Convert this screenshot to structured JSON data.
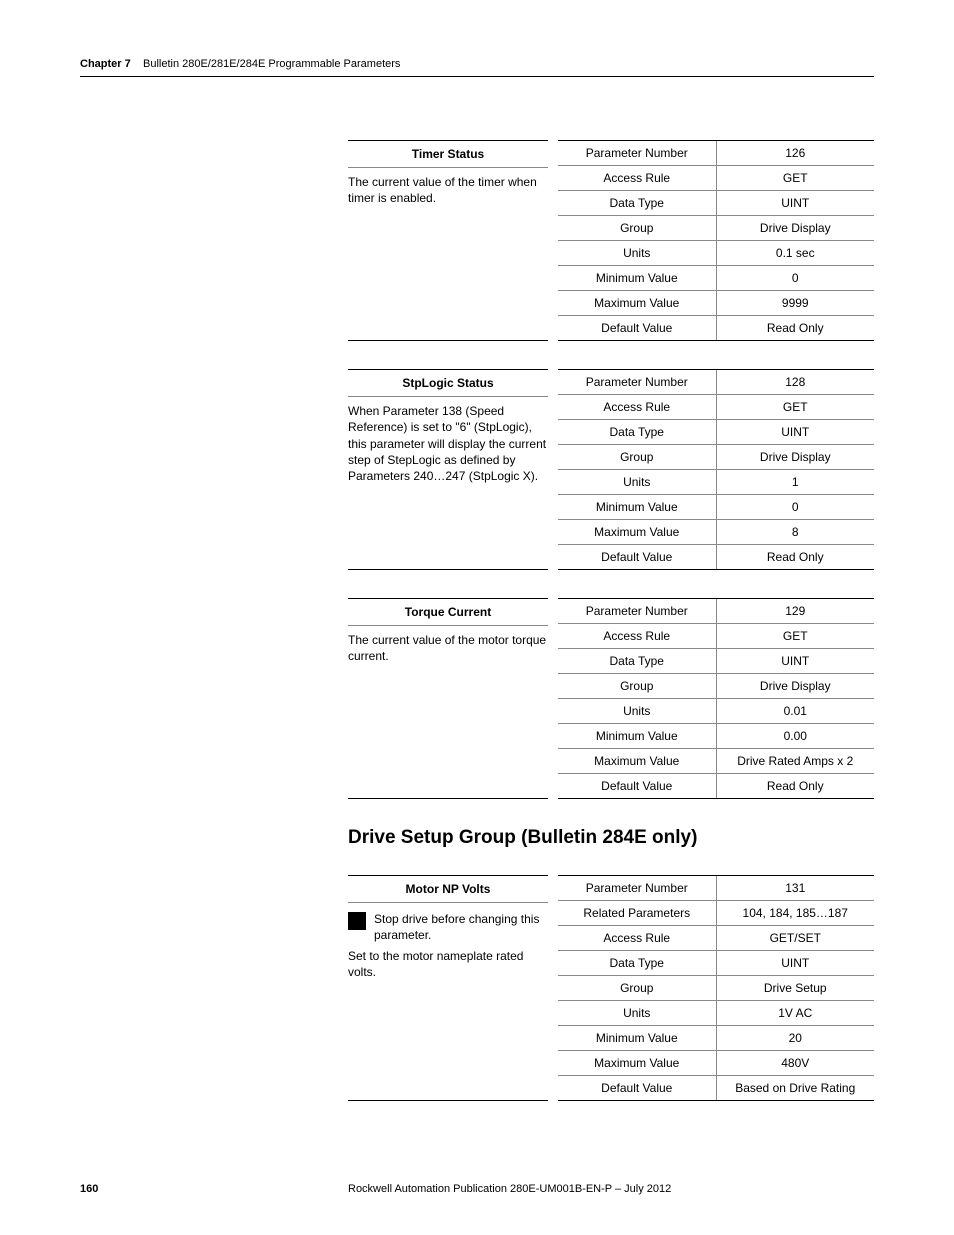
{
  "header": {
    "chapter": "Chapter 7",
    "title": "Bulletin 280E/281E/284E Programmable Parameters"
  },
  "params": [
    {
      "title": "Timer Status",
      "desc": "The current value of the timer when timer is enabled.",
      "rows": [
        {
          "label": "Parameter Number",
          "value": "126"
        },
        {
          "label": "Access Rule",
          "value": "GET"
        },
        {
          "label": "Data Type",
          "value": "UINT"
        },
        {
          "label": "Group",
          "value": "Drive Display"
        },
        {
          "label": "Units",
          "value": "0.1 sec"
        },
        {
          "label": "Minimum Value",
          "value": "0"
        },
        {
          "label": "Maximum Value",
          "value": "9999"
        },
        {
          "label": "Default Value",
          "value": "Read Only"
        }
      ]
    },
    {
      "title": "StpLogic Status",
      "desc": "When Parameter 138 (Speed Reference) is set to \"6\" (StpLogic), this parameter will display the current step of StepLogic as defined by Parameters 240…247 (StpLogic X).",
      "rows": [
        {
          "label": "Parameter Number",
          "value": "128"
        },
        {
          "label": "Access Rule",
          "value": "GET"
        },
        {
          "label": "Data Type",
          "value": "UINT"
        },
        {
          "label": "Group",
          "value": "Drive Display"
        },
        {
          "label": "Units",
          "value": "1"
        },
        {
          "label": "Minimum Value",
          "value": "0"
        },
        {
          "label": "Maximum Value",
          "value": "8"
        },
        {
          "label": "Default Value",
          "value": "Read Only"
        }
      ]
    },
    {
      "title": "Torque Current",
      "desc": "The current value of the motor torque current.",
      "rows": [
        {
          "label": "Parameter Number",
          "value": "129"
        },
        {
          "label": "Access Rule",
          "value": "GET"
        },
        {
          "label": "Data Type",
          "value": "UINT"
        },
        {
          "label": "Group",
          "value": "Drive Display"
        },
        {
          "label": "Units",
          "value": "0.01"
        },
        {
          "label": "Minimum Value",
          "value": "0.00"
        },
        {
          "label": "Maximum Value",
          "value": "Drive Rated Amps x 2"
        },
        {
          "label": "Default Value",
          "value": "Read Only"
        }
      ]
    }
  ],
  "section_heading": "Drive Setup Group (Bulletin 284E only)",
  "param_motor": {
    "title": "Motor NP Volts",
    "stop_note": "Stop drive before changing this parameter.",
    "desc2": "Set to the motor nameplate rated volts.",
    "rows": [
      {
        "label": "Parameter Number",
        "value": "131"
      },
      {
        "label": "Related Parameters",
        "value": "104, 184, 185…187"
      },
      {
        "label": "Access Rule",
        "value": "GET/SET"
      },
      {
        "label": "Data Type",
        "value": "UINT"
      },
      {
        "label": "Group",
        "value": "Drive Setup"
      },
      {
        "label": "Units",
        "value": "1V AC"
      },
      {
        "label": "Minimum Value",
        "value": "20"
      },
      {
        "label": "Maximum Value",
        "value": "480V"
      },
      {
        "label": "Default Value",
        "value": "Based on Drive Rating"
      }
    ]
  },
  "footer": {
    "page": "160",
    "pub": "Rockwell Automation Publication 280E-UM001B-EN-P – July 2012"
  }
}
